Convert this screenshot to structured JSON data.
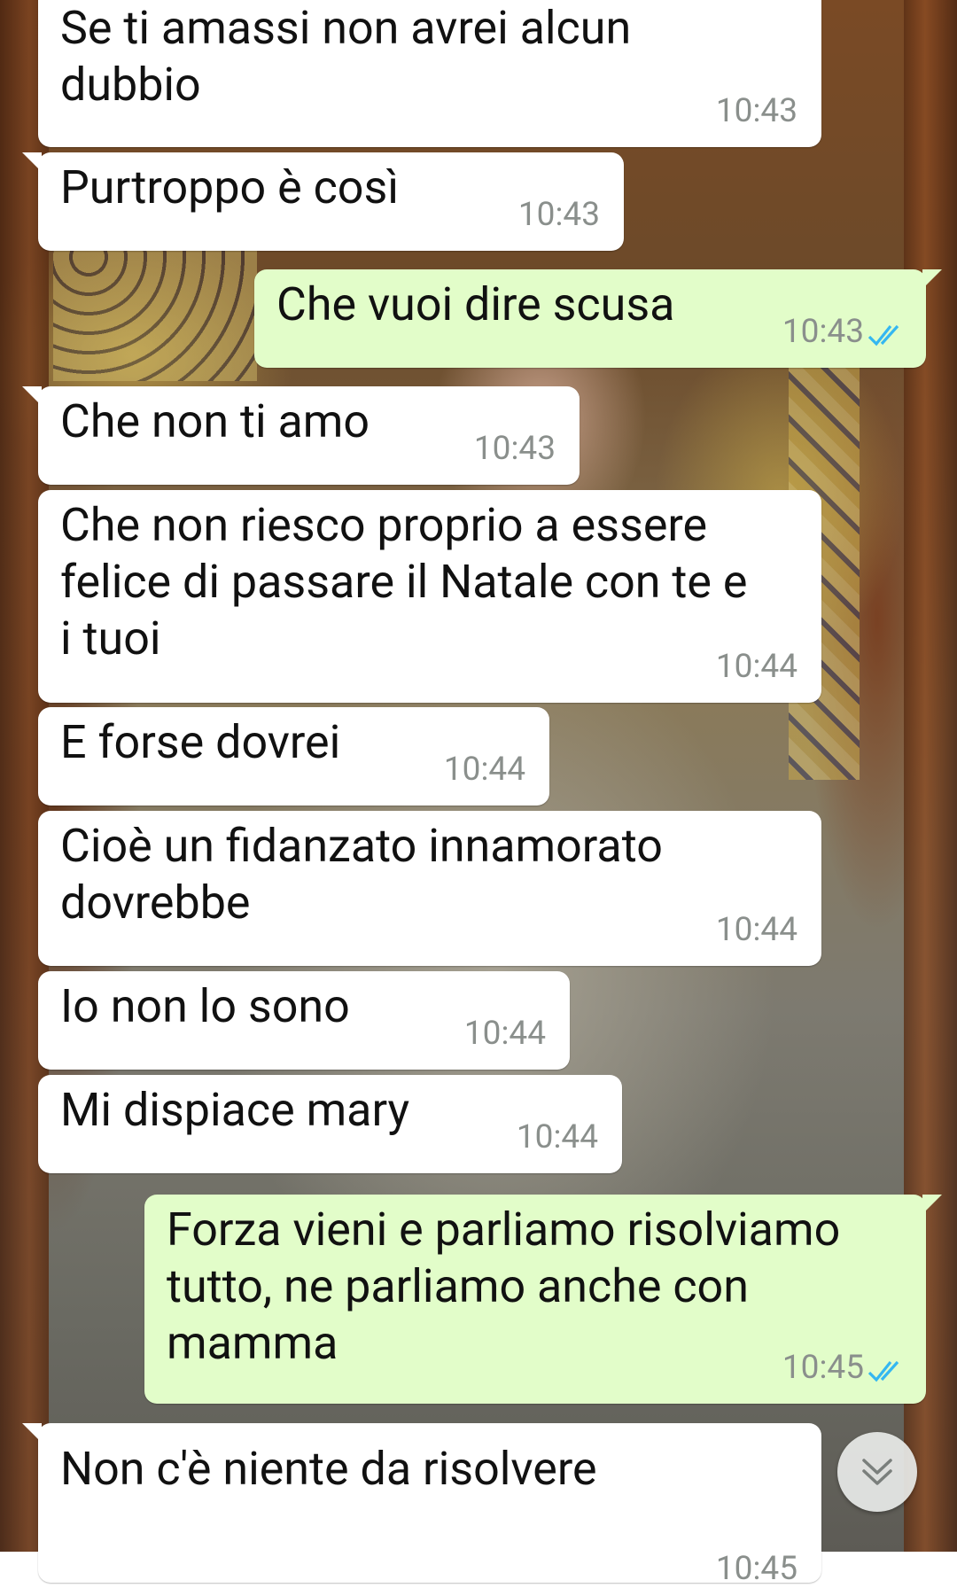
{
  "colors": {
    "incoming_bubble": "#ffffff",
    "outgoing_bubble": "#e2fdc9",
    "timestamp": "#8a8f8c",
    "read_ticks": "#34b7f1"
  },
  "messages": [
    {
      "direction": "incoming",
      "text": "Se ti amassi non avrei alcun\ndubbio",
      "time": "10:43"
    },
    {
      "direction": "incoming",
      "text": "Purtroppo è così",
      "time": "10:43"
    },
    {
      "direction": "outgoing",
      "text": "Che vuoi dire scusa",
      "time": "10:43",
      "status": "read-double-check-icon"
    },
    {
      "direction": "incoming",
      "text": "Che non ti amo",
      "time": "10:43"
    },
    {
      "direction": "incoming",
      "text": "Che non riesco proprio a essere\nfelice di passare il Natale con te e\ni tuoi",
      "time": "10:44"
    },
    {
      "direction": "incoming",
      "text": "E forse dovrei",
      "time": "10:44"
    },
    {
      "direction": "incoming",
      "text": "Cioè un fidanzato innamorato\ndovrebbe",
      "time": "10:44"
    },
    {
      "direction": "incoming",
      "text": "Io non lo sono",
      "time": "10:44"
    },
    {
      "direction": "incoming",
      "text": "Mi dispiace mary",
      "time": "10:44"
    },
    {
      "direction": "outgoing",
      "text": "Forza vieni e parliamo risolviamo\ntutto, ne parliamo anche con\nmamma",
      "time": "10:45",
      "status": "read-double-check-icon"
    },
    {
      "direction": "incoming",
      "text": "Non c'è niente da risolvere",
      "time": "10:45"
    }
  ],
  "scroll_to_bottom": {
    "icon": "double-chevron-down-icon"
  }
}
